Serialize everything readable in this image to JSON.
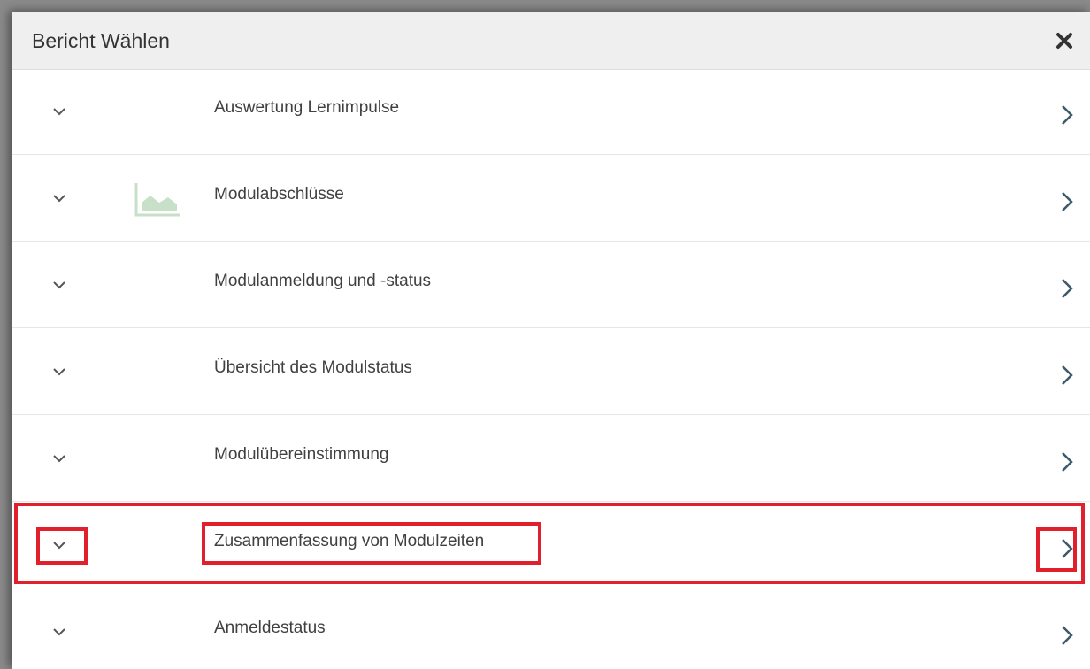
{
  "dialog": {
    "title": "Bericht Wählen",
    "close_icon": "close-icon"
  },
  "reports": [
    {
      "label": "Auswertung Lernimpulse",
      "icon": null
    },
    {
      "label": "Modulabschlüsse",
      "icon": "area-chart-icon"
    },
    {
      "label": "Modulanmeldung und -status",
      "icon": null
    },
    {
      "label": "Übersicht des Modulstatus",
      "icon": null
    },
    {
      "label": "Modulübereinstimmung",
      "icon": null
    },
    {
      "label": "Zusammenfassung von Modulzeiten",
      "icon": null,
      "highlighted": true
    },
    {
      "label": "Anmeldestatus",
      "icon": null
    }
  ],
  "colors": {
    "highlight": "#e0202c",
    "chevron": "#3d5a6a",
    "chart_icon": "#c8dfc8"
  }
}
